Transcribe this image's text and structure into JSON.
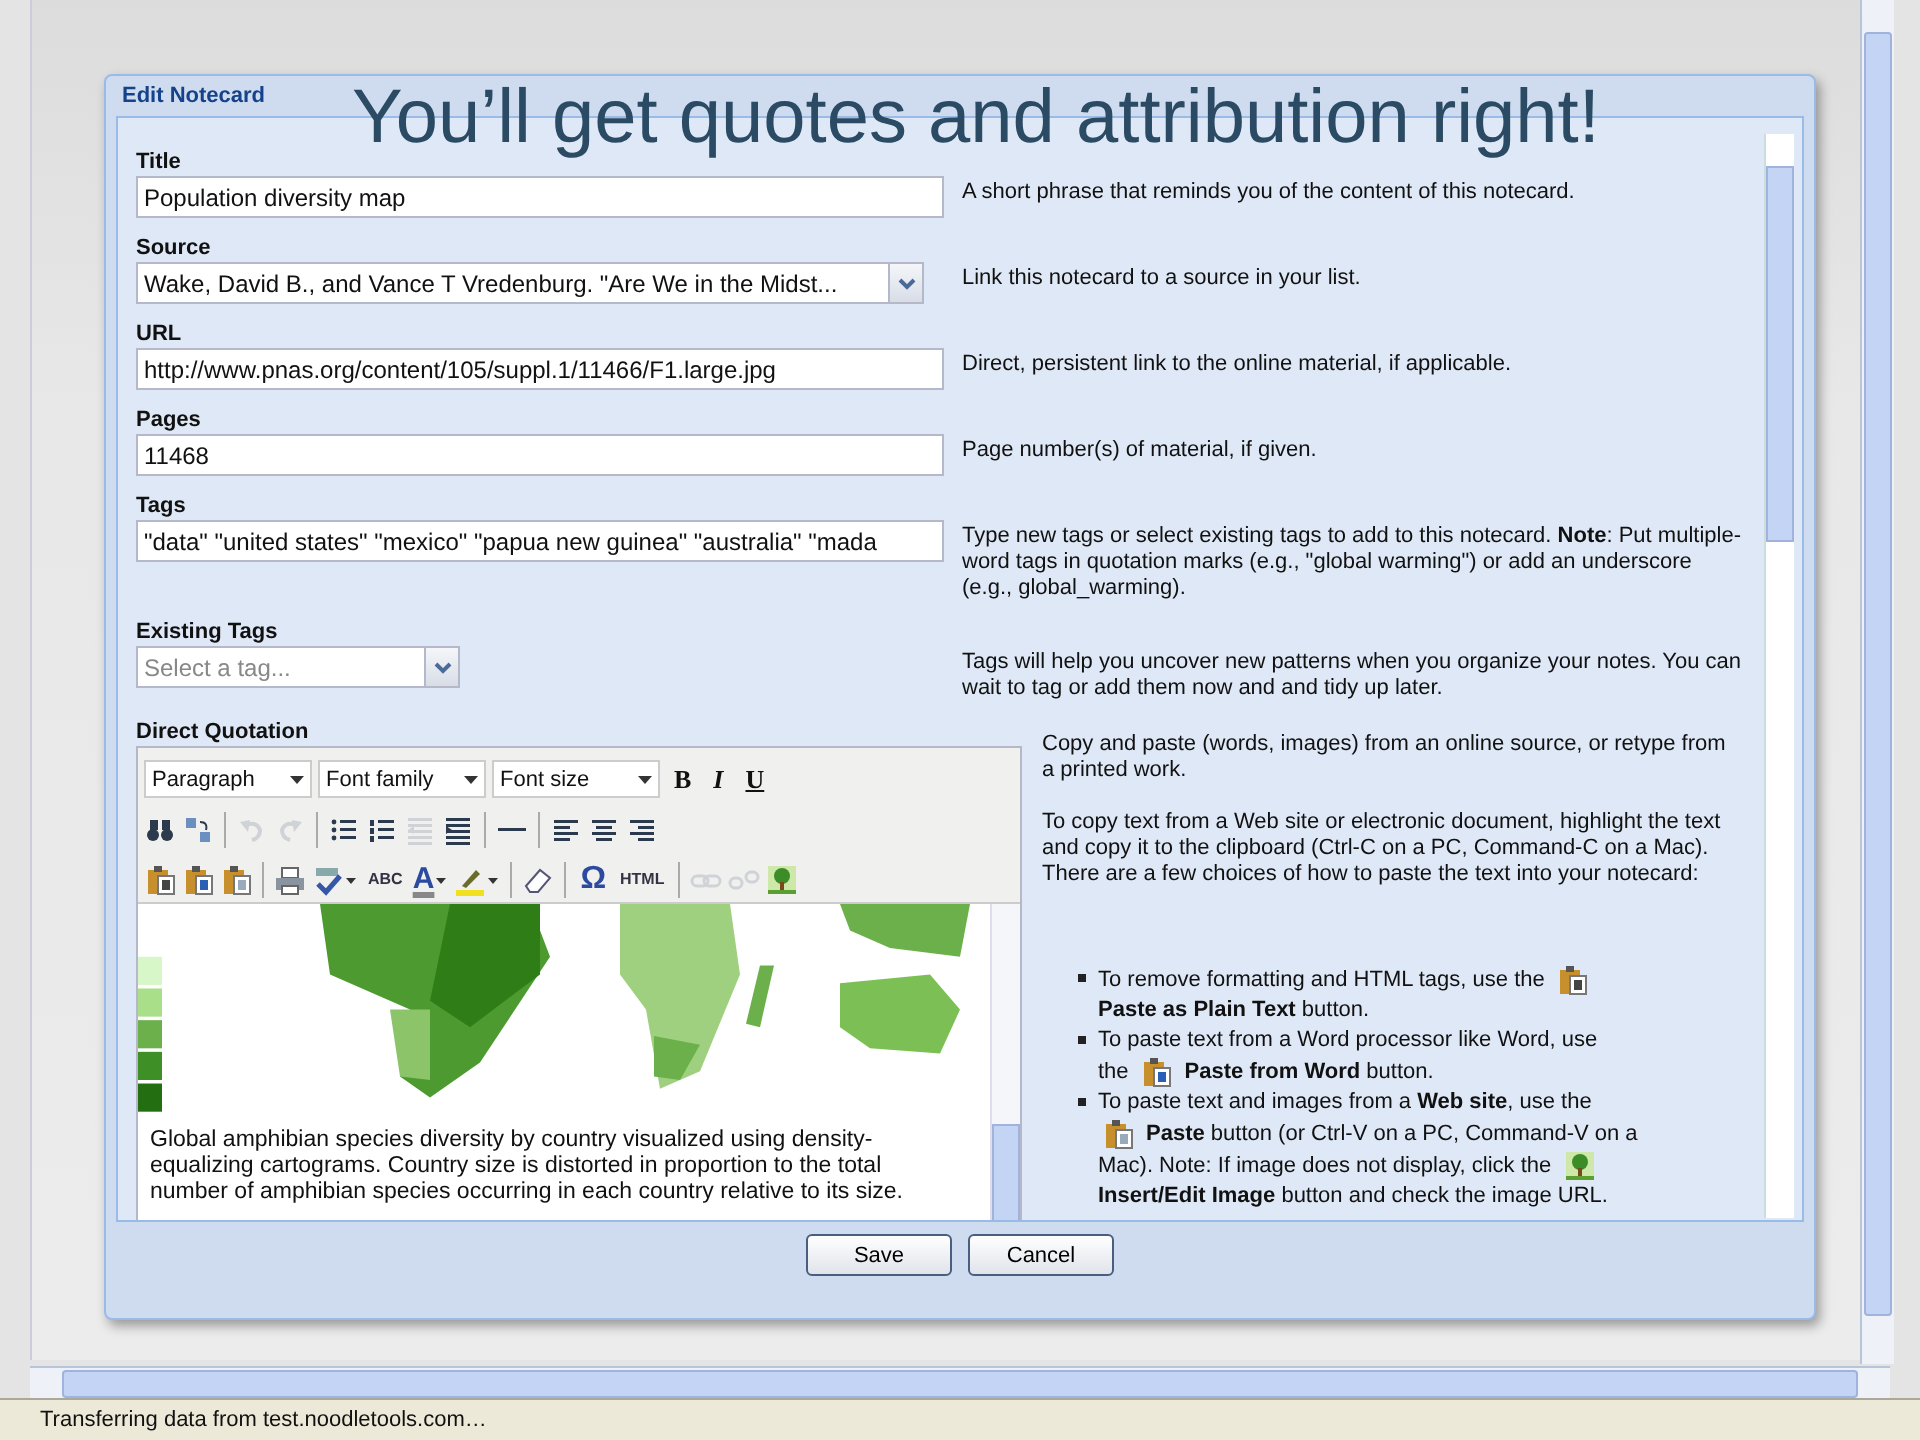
{
  "headline": "You’ll get quotes and attribution right!",
  "dialog": {
    "title": "Edit Notecard",
    "fields": [
      {
        "kind": "text",
        "label": "Title",
        "value": "Population diversity map",
        "help": "A short phrase that reminds you of the content of this notecard."
      },
      {
        "kind": "select",
        "label": "Source",
        "value": "Wake, David B., and Vance T Vredenburg. \"Are We in the Midst...",
        "help": "Link this notecard to a source in your list."
      },
      {
        "kind": "text",
        "label": "URL",
        "value": "http://www.pnas.org/content/105/suppl.1/11466/F1.large.jpg",
        "help": "Direct, persistent link to the online material, if applicable."
      },
      {
        "kind": "text",
        "label": "Pages",
        "value": "11468",
        "help": "Page number(s) of material, if given."
      },
      {
        "kind": "text",
        "label": "Tags",
        "value": " \"data\"  \"united states\"  \"mexico\"  \"papua new guinea\"  \"australia\"  \"mada",
        "help": "Type new tags or select existing tags to add to this notecard. **Note**: Put multiple-word tags in quotation marks (e.g., \"global warming\") or add an underscore (e.g., global_warming)."
      },
      {
        "kind": "short-select",
        "label": "Existing Tags",
        "placeholder": "Select a tag...",
        "help": "Tags will help you uncover new patterns when you organize your notes. You can wait to tag or add them now and and tidy up later."
      }
    ],
    "quotation": {
      "label": "Direct Quotation",
      "toolbar_rows": [
        [
          {
            "kind": "dropdown",
            "label": "Paragraph"
          },
          {
            "kind": "dropdown",
            "label": "Font family"
          },
          {
            "kind": "dropdown",
            "label": "Font size"
          },
          {
            "kind": "bold",
            "label": "B"
          },
          {
            "kind": "italic",
            "label": "I"
          },
          {
            "kind": "underline",
            "label": "U"
          }
        ],
        [
          {
            "kind": "find",
            "disabled": false
          },
          {
            "kind": "replace",
            "disabled": false
          },
          {
            "kind": "separator"
          },
          {
            "kind": "undo",
            "disabled": true
          },
          {
            "kind": "redo",
            "disabled": true
          },
          {
            "kind": "separator"
          },
          {
            "kind": "bullets",
            "disabled": false
          },
          {
            "kind": "numbers",
            "disabled": false
          },
          {
            "kind": "outdent",
            "disabled": true
          },
          {
            "kind": "indent",
            "disabled": false
          },
          {
            "kind": "separator"
          },
          {
            "kind": "rule",
            "disabled": false
          },
          {
            "kind": "separator"
          },
          {
            "kind": "align-left",
            "disabled": false
          },
          {
            "kind": "align-center",
            "disabled": false
          },
          {
            "kind": "align-right",
            "disabled": false
          }
        ],
        [
          {
            "kind": "paste-text",
            "disabled": false
          },
          {
            "kind": "paste-word",
            "disabled": false
          },
          {
            "kind": "paste",
            "disabled": false
          },
          {
            "kind": "separator"
          },
          {
            "kind": "print",
            "disabled": false
          },
          {
            "kind": "spell",
            "disabled": false,
            "menu": true
          },
          {
            "kind": "char",
            "label": "ABC",
            "small": true
          },
          {
            "kind": "text-color",
            "label": "A",
            "menu": true
          },
          {
            "kind": "highlight",
            "disabled": false,
            "menu": true
          },
          {
            "kind": "separator"
          },
          {
            "kind": "eraser",
            "disabled": false
          },
          {
            "kind": "separator"
          },
          {
            "kind": "char",
            "label": "Ω",
            "small": false
          },
          {
            "kind": "char",
            "label": "HTML",
            "small": true
          },
          {
            "kind": "separator"
          },
          {
            "kind": "link",
            "disabled": true
          },
          {
            "kind": "unlink",
            "disabled": true
          },
          {
            "kind": "image",
            "disabled": false
          }
        ]
      ],
      "caption": "Global amphibian species diversity by country visualized using density-equalizing cartograms. Country size is distorted in proportion to the total number of amphibian species occurring in each country relative to its size.",
      "help_paragraphs": [
        "Copy and paste (words, images) from an online source, or retype from a printed work.",
        "To copy text from a Web site or electronic document, highlight the text and copy it to the clipboard (Ctrl-C on a PC, Command-C on a Mac). There are a few choices of how to paste the text into your notecard:"
      ],
      "help_bullets": [
        [
          [
            {
              "kind": "text",
              "text": "To remove formatting and HTML tags, use the"
            },
            {
              "kind": "paste-text"
            }
          ],
          [
            {
              "kind": "text",
              "text": "**Paste as Plain Text** button."
            }
          ]
        ],
        [
          [
            {
              "kind": "text",
              "text": "To paste text from a Word processor like Word, use"
            }
          ],
          [
            {
              "kind": "text",
              "text": "the"
            },
            {
              "kind": "paste-word"
            },
            {
              "kind": "text",
              "text": "**Paste from Word** button."
            }
          ]
        ],
        [
          [
            {
              "kind": "text",
              "text": "To paste text and images from a **Web site**, use the"
            }
          ],
          [
            {
              "kind": "paste"
            },
            {
              "kind": "text",
              "text": "**Paste** button (or Ctrl-V on a PC, Command-V on a"
            }
          ],
          [
            {
              "kind": "text",
              "text": "Mac). Note: If image does not display, click the"
            },
            {
              "kind": "image"
            }
          ],
          [
            {
              "kind": "text",
              "text": "**Insert/Edit Image** button and check the image URL."
            }
          ]
        ]
      ]
    },
    "buttons": [
      "Save",
      "Cancel"
    ]
  },
  "status_bar": "Transferring data from test.noodletools.com…"
}
